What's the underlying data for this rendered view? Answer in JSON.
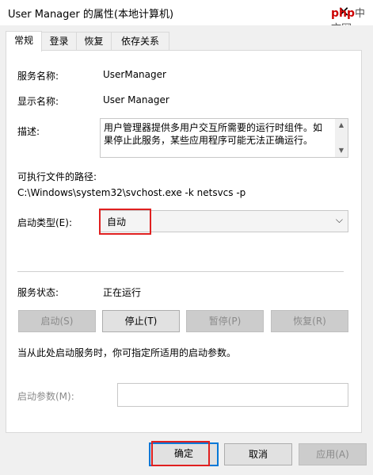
{
  "window": {
    "title": "User Manager 的属性(本地计算机)",
    "close_glyph": "✕"
  },
  "watermark": {
    "brand": "php",
    "suffix": "中文网"
  },
  "tabs": [
    "常规",
    "登录",
    "恢复",
    "依存关系"
  ],
  "general": {
    "service_name_label": "服务名称:",
    "service_name": "UserManager",
    "display_name_label": "显示名称:",
    "display_name": "User Manager",
    "description_label": "描述:",
    "description": "用户管理器提供多用户交互所需要的运行时组件。如果停止此服务，某些应用程序可能无法正确运行。",
    "path_label": "可执行文件的路径:",
    "path": "C:\\Windows\\system32\\svchost.exe -k netsvcs -p",
    "startup_type_label": "启动类型(E):",
    "startup_type": "自动",
    "status_label": "服务状态:",
    "status": "正在运行",
    "buttons": {
      "start": "启动(S)",
      "stop": "停止(T)",
      "pause": "暂停(P)",
      "resume": "恢复(R)"
    },
    "hint": "当从此处启动服务时，你可指定所适用的启动参数。",
    "params_label": "启动参数(M):",
    "params_value": ""
  },
  "footer": {
    "ok": "确定",
    "cancel": "取消",
    "apply": "应用(A)"
  },
  "colors": {
    "highlight": "#e02020",
    "focus": "#0078d7"
  }
}
